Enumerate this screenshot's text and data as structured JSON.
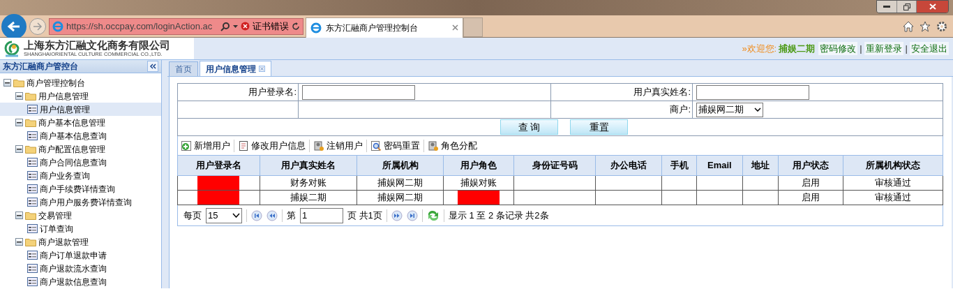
{
  "browser": {
    "url": "https://sh.occpay.com/loginAction.ac",
    "cert_error": "证书错误",
    "tabs": [
      {
        "title": "东方汇融商户管理控制台",
        "selected": true
      }
    ]
  },
  "header": {
    "company_cn": "上海东方汇融文化商务有限公司",
    "company_en": "SHANGHAIORIENTAL CULTURE COMMERCIAL CO.,LTD.",
    "welcome": "»欢迎您:",
    "user": "捕娱二期",
    "links": [
      "密码修改",
      "重新登录",
      "安全退出"
    ],
    "separator": "|"
  },
  "sidebar": {
    "title": "东方汇融商户管控台",
    "tree": [
      {
        "label": "商户管理控制台",
        "expanded": true,
        "children": [
          {
            "label": "用户信息管理",
            "expanded": true,
            "children": [
              {
                "label": "用户信息管理",
                "selected": true
              }
            ]
          },
          {
            "label": "商户基本信息管理",
            "expanded": true,
            "children": [
              {
                "label": "商户基本信息查询",
                "selected": false
              }
            ]
          },
          {
            "label": "商户配置信息管理",
            "expanded": true,
            "children": [
              {
                "label": "商户合同信息查询",
                "selected": false
              },
              {
                "label": "商户业务查询",
                "selected": false
              },
              {
                "label": "商户手续费详情查询",
                "selected": false
              },
              {
                "label": "商户用户服务费详情查询",
                "selected": false
              }
            ]
          },
          {
            "label": "交易管理",
            "expanded": true,
            "children": [
              {
                "label": "订单查询",
                "selected": false
              }
            ]
          },
          {
            "label": "商户退款管理",
            "expanded": true,
            "children": [
              {
                "label": "商户订单退款申请",
                "selected": false
              },
              {
                "label": "商户退款流水查询",
                "selected": false
              },
              {
                "label": "商户退款信息查询",
                "selected": false
              }
            ]
          }
        ]
      }
    ]
  },
  "main_tabs": [
    {
      "label": "首页",
      "selected": false,
      "closable": false
    },
    {
      "label": "用户信息管理",
      "selected": true,
      "closable": true
    }
  ],
  "search_form": {
    "fields": [
      {
        "label": "用户登录名:",
        "kind": "text"
      },
      {
        "label": "用户真实姓名:",
        "kind": "text"
      },
      {
        "label": "商户:",
        "kind": "select",
        "value": "捕娱网二期"
      }
    ],
    "buttons": [
      "查 询",
      "重置"
    ]
  },
  "toolbar": [
    {
      "label": "新增用户",
      "kind": "add"
    },
    {
      "label": "修改用户信息",
      "kind": "edit"
    },
    {
      "label": "注销用户",
      "kind": "user"
    },
    {
      "label": "密码重置",
      "kind": "search"
    },
    {
      "label": "角色分配",
      "kind": "user"
    }
  ],
  "table": {
    "columns": [
      "用户登录名",
      "用户真实姓名",
      "所属机构",
      "用户角色",
      "身份证号码",
      "办公电话",
      "手机",
      "Email",
      "地址",
      "用户状态",
      "所属机构状态"
    ],
    "rows": [
      {
        "cells": [
          {
            "redacted": true
          },
          {
            "text": "财务对账"
          },
          {
            "text": "捕娱网二期"
          },
          {
            "text": "捕娱对账"
          },
          {},
          {},
          {},
          {},
          {},
          {
            "text": "启用"
          },
          {
            "text": "审核通过"
          }
        ]
      },
      {
        "cells": [
          {
            "redacted": true
          },
          {
            "text": "捕娱二期"
          },
          {
            "text": "捕娱网二期"
          },
          {
            "redacted": true
          },
          {},
          {},
          {},
          {},
          {},
          {
            "text": "启用"
          },
          {
            "text": "审核通过"
          }
        ]
      }
    ]
  },
  "pager": {
    "per_page_label": "每页",
    "per_page": "15",
    "page_prefix": "第",
    "page": "1",
    "page_suffix": "页 共1页",
    "summary": "显示 1 至 2 条记录 共2条"
  }
}
